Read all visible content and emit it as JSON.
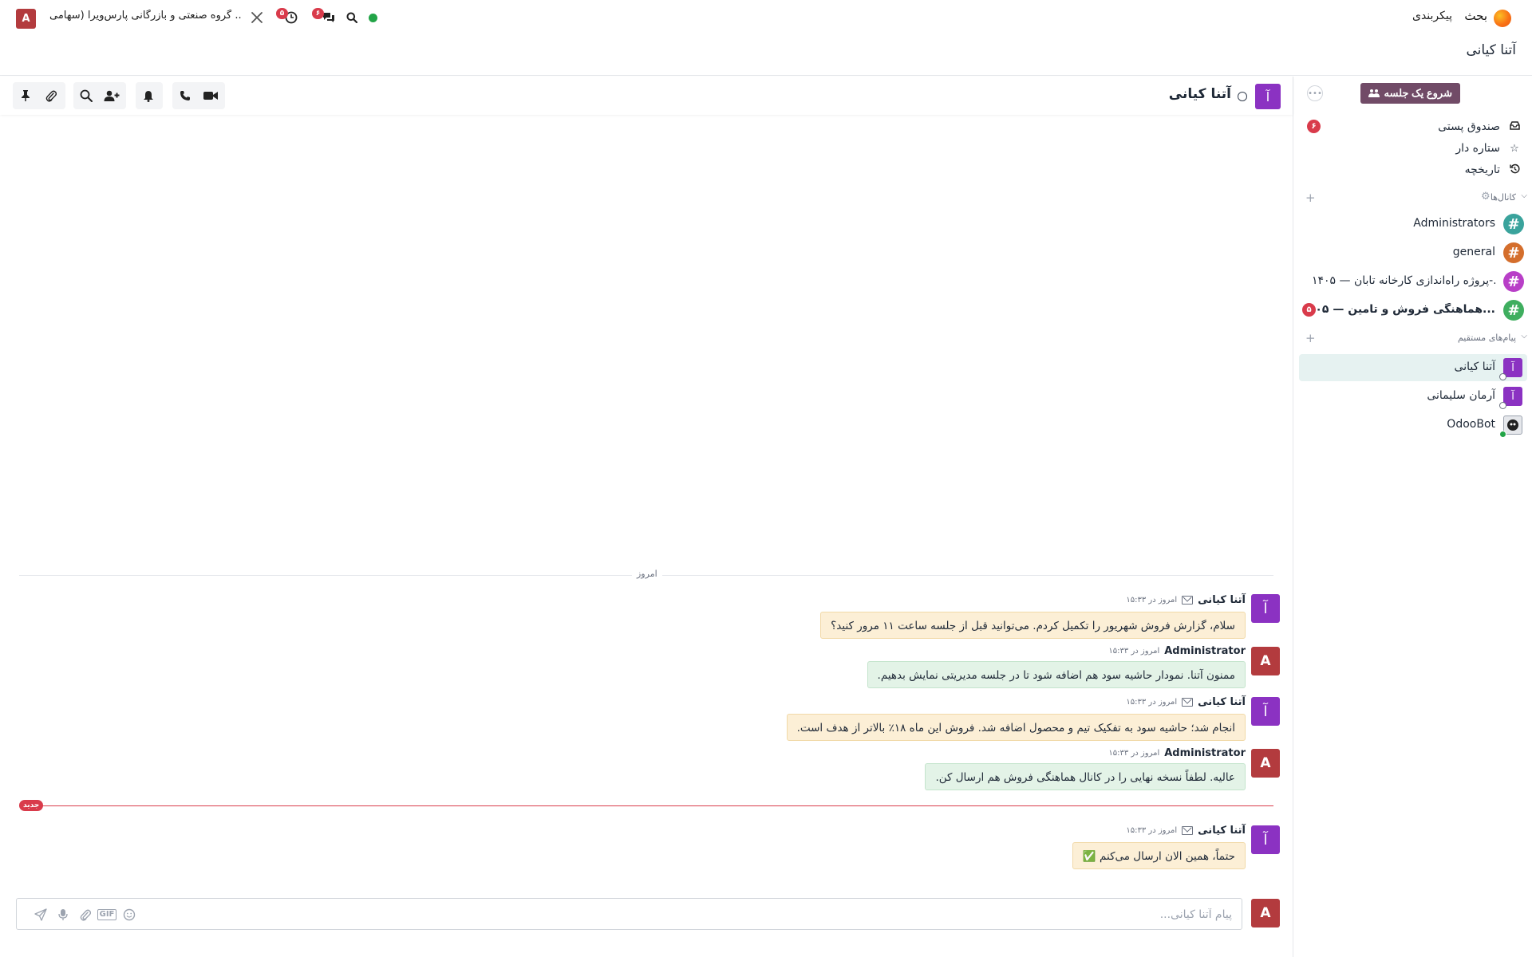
{
  "navbar": {
    "app_name": "بحث",
    "config_label": "پیکربندی",
    "company_avatar": "A",
    "company_name": "گروه صنعتی و بازرگانی پارس‌ویرا (سهامی ...",
    "activity_badge": "۵",
    "messages_badge": "۶",
    "icons": [
      "tools-icon",
      "clock-icon",
      "chat-icon",
      "search-icon"
    ],
    "presence_color": "#22a447"
  },
  "page": {
    "title": "آتنا کیانی"
  },
  "sidebar": {
    "start_meeting": "شروع یک جلسه",
    "mailboxes": [
      {
        "label": "صندوق پستی",
        "icon": "inbox-icon",
        "badge": "۶"
      },
      {
        "label": "ستاره دار",
        "icon": "star-icon",
        "badge": ""
      },
      {
        "label": "تاریخچه",
        "icon": "history-icon",
        "badge": ""
      }
    ],
    "channels_header": "کانال‌ها",
    "channels": [
      {
        "name": "Administrators",
        "color": "#3aa39c",
        "bold": false,
        "badge": ""
      },
      {
        "name": "general",
        "color": "#d46e2c",
        "bold": false,
        "badge": ""
      },
      {
        "name": "پروژه راه‌اندازی کارخانه تابان — ۱۴۰۵-...",
        "color": "#b83fc7",
        "bold": false,
        "badge": ""
      },
      {
        "name": "هماهنگی فروش و تامین — ۰۵...",
        "color": "#3fae5f",
        "bold": true,
        "badge": "۵"
      }
    ],
    "dm_header": "پیام‌های مستقیم",
    "dms": [
      {
        "name": "آتنا کیانی",
        "avatar": "آ",
        "active": true,
        "online": false
      },
      {
        "name": "آرمان سلیمانی",
        "avatar": "آ",
        "active": false,
        "online": false
      },
      {
        "name": "OdooBot",
        "avatar": "",
        "active": false,
        "online": true
      }
    ]
  },
  "thread": {
    "avatar": "آ",
    "name": "آتنا کیانی",
    "divider": "امروز",
    "new_label": "جدید",
    "messages": [
      {
        "author": "آتنا کیانی",
        "time": "امروز در ۱۵:۳۳",
        "text": "سلام، گزارش فروش شهریور را تکمیل کردم. می‌توانید قبل از جلسه ساعت ۱۱ مرور کنید؟",
        "avatar": "آ",
        "incoming": true
      },
      {
        "author": "Administrator",
        "time": "امروز در ۱۵:۳۳",
        "text": "ممنون آتنا. نمودار حاشیه سود هم اضافه شود تا در جلسه مدیریتی نمایش بدهیم.",
        "avatar": "A",
        "incoming": false
      },
      {
        "author": "آتنا کیانی",
        "time": "امروز در ۱۵:۳۳",
        "text": "انجام شد؛ حاشیه سود به تفکیک تیم و محصول اضافه شد. فروش این ماه ۱۸٪ بالاتر از هدف است.",
        "avatar": "آ",
        "incoming": true
      },
      {
        "author": "Administrator",
        "time": "امروز در ۱۵:۳۳",
        "text": "عالیه. لطفاً نسخه نهایی را در کانال هماهنگی فروش هم ارسال کن.",
        "avatar": "A",
        "incoming": false
      },
      {
        "author": "آتنا کیانی",
        "time": "امروز در ۱۵:۳۳",
        "text": "حتماً، همین الان ارسال می‌کنم ✅",
        "avatar": "آ",
        "incoming": true
      }
    ]
  },
  "composer": {
    "avatar": "A",
    "placeholder": "پیام آتنا کیانی...",
    "gif_label": "GIF"
  }
}
